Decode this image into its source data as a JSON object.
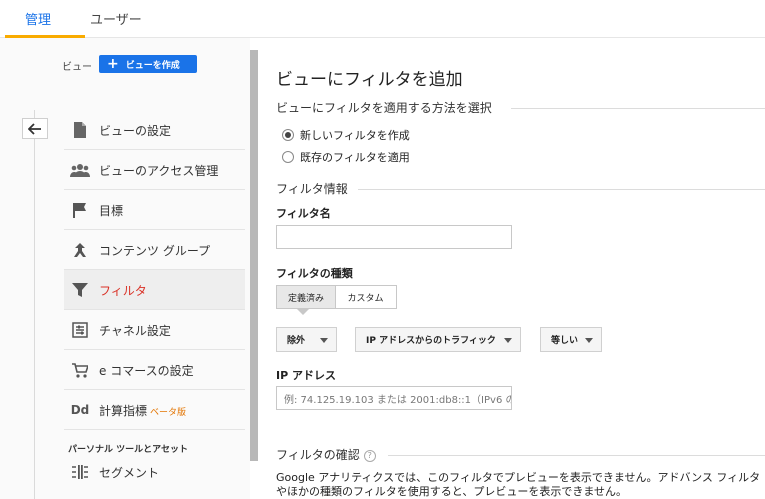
{
  "tabs": {
    "admin": "管理",
    "user": "ユーザー"
  },
  "accent_colors": {
    "tab_active": "#1a73e8",
    "tab_underline": "#f9ab00",
    "nav_active": "#d93025",
    "beta": "#e37400"
  },
  "view_selector": {
    "label": "ビュー",
    "create_button": "ビューを作成"
  },
  "nav": {
    "items": [
      {
        "label": "ビューの設定",
        "icon": "document-icon"
      },
      {
        "label": "ビューのアクセス管理",
        "icon": "people-icon"
      },
      {
        "label": "目標",
        "icon": "flag-icon"
      },
      {
        "label": "コンテンツ グループ",
        "icon": "content-group-icon"
      },
      {
        "label": "フィルタ",
        "icon": "filter-icon",
        "active": true
      },
      {
        "label": "チャネル設定",
        "icon": "channel-icon"
      },
      {
        "label": "e コマースの設定",
        "icon": "cart-icon"
      },
      {
        "label": "計算指標",
        "icon": "dd-icon",
        "badge": "ベータ版"
      }
    ],
    "section_header": "パーソナル ツールとアセット",
    "segment_label": "セグメント"
  },
  "main": {
    "title": "ビューにフィルタを追加",
    "method_section": "ビューにフィルタを適用する方法を選択",
    "radio_new": "新しいフィルタを作成",
    "radio_existing": "既存のフィルタを適用",
    "info_section": "フィルタ情報",
    "filter_name_label": "フィルタ名",
    "filter_name_value": "",
    "filter_type_label": "フィルタの種類",
    "seg_predefined": "定義済み",
    "seg_custom": "カスタム",
    "dropdown_exclude": "除外",
    "dropdown_source": "IP アドレスからのトラフィック",
    "dropdown_expression": "等しい",
    "ip_label": "IP アドレス",
    "ip_placeholder": "例: 74.125.19.103 または 2001:db8::1（IPv6 の",
    "verify_section": "フィルタの確認",
    "verify_help": "?",
    "note": "Google アナリティクスでは、このフィルタでプレビューを表示できません。アドバンス フィルタやほかの種類のフィルタを使用すると、プレビューを表示できません。"
  }
}
